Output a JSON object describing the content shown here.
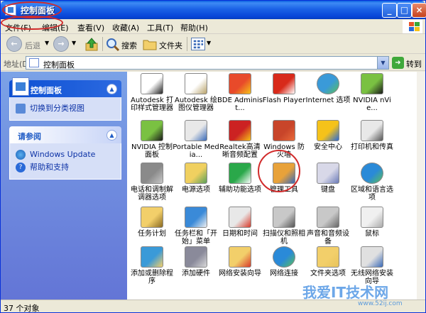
{
  "window": {
    "title": "控制面板",
    "controls": [
      "_",
      "□",
      "×"
    ]
  },
  "menubar": {
    "items": [
      "文件(F)",
      "编辑(E)",
      "查看(V)",
      "收藏(A)",
      "工具(T)",
      "帮助(H)"
    ]
  },
  "toolbar": {
    "back_label": "后退",
    "search_label": "搜索",
    "folders_label": "文件夹"
  },
  "address": {
    "label": "地址(D)",
    "value": "控制面板",
    "go_label": "转到"
  },
  "left_pane": {
    "primary_panel": {
      "title": "控制面板",
      "links": [
        "切换到分类视图"
      ]
    },
    "see_also_panel": {
      "title": "请参阅",
      "links": [
        "Windows Update",
        "帮助和支持"
      ]
    }
  },
  "icons": [
    "Autodesk 打印样式管理器",
    "Autodesk 绘图仪管理器",
    "BDE Administ...",
    "Flash Player",
    "Internet 选项",
    "NVIDIA nVie...",
    "NVIDIA 控制面板",
    "Portable Media...",
    "Realtek高清晰音频配置",
    "Windows 防火墙",
    "安全中心",
    "打印机和传真",
    "电话和调制解调器选项",
    "电源选项",
    "辅助功能选项",
    "管理工具",
    "键盘",
    "区域和语言选项",
    "任务计划",
    "任务栏和「开始」菜单",
    "日期和时间",
    "扫描仪和照相机",
    "声音和音频设备",
    "鼠标",
    "添加或删除程序",
    "添加硬件",
    "网络安装向导",
    "网络连接",
    "文件夹选项",
    "无线网络安装向导"
  ],
  "highlighted_icon": "管理工具",
  "status": {
    "text": "37 个对象"
  },
  "watermark": {
    "text": "我爱IT技术网",
    "url": "www.52ij.com"
  }
}
